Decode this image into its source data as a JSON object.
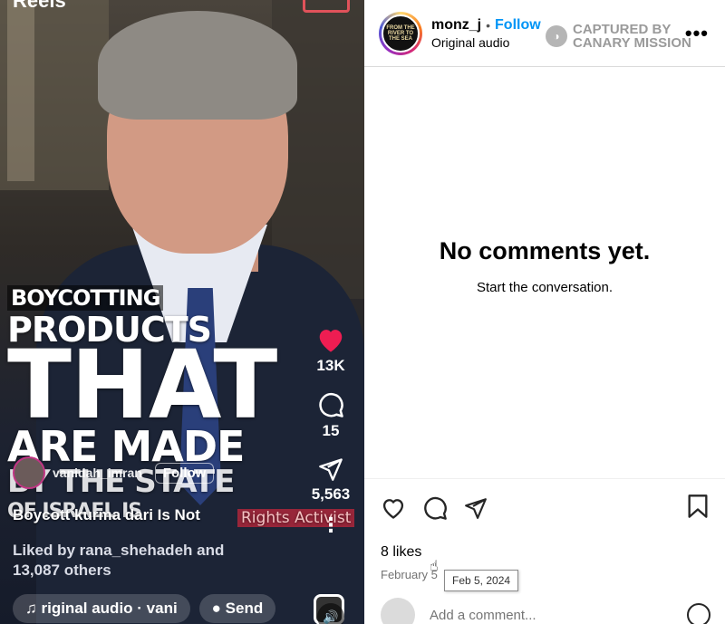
{
  "video": {
    "top_label": "Reels",
    "overlay_lines": [
      "BOYCOTTING",
      "PRODUCTS",
      "THAT",
      "ARE MADE",
      "BY THE STATE",
      "OF ISRAEL IS",
      "Rights Activist"
    ],
    "author": {
      "name": "vanidah_imran",
      "follow_label": "Follow"
    },
    "caption": "Boycott kurma dari Is Not",
    "liked_line1": "Liked by rana_shehadeh and",
    "liked_line2": "13,087 others",
    "audio_label": "riginal audio · vani",
    "send_label": "Send",
    "likes_count": "13K",
    "comments_count": "15",
    "shares_count": "5,563",
    "more_glyph": "⋮",
    "speaker_glyph": "🔊"
  },
  "post": {
    "avatar_text": "FROM THE RIVER TO THE SEA",
    "username": "monz_j",
    "separator": "•",
    "follow_label": "Follow",
    "audio": "Original audio",
    "watermark_line1": "CAPTURED BY",
    "watermark_line2": "CANARY MISSION",
    "more_glyph": "•••",
    "no_comments_title": "No comments yet.",
    "no_comments_sub": "Start the conversation.",
    "likes": "8 likes",
    "date": "February 5",
    "tooltip": "Feb 5, 2024",
    "comment_placeholder": "Add a comment..."
  },
  "colors": {
    "accent": "#0095f6",
    "heart": "#ee1d52"
  },
  "icons": [
    "heart-icon",
    "comment-icon",
    "share-icon",
    "bookmark-icon",
    "emoji-icon",
    "more-icon",
    "speaker-icon"
  ]
}
